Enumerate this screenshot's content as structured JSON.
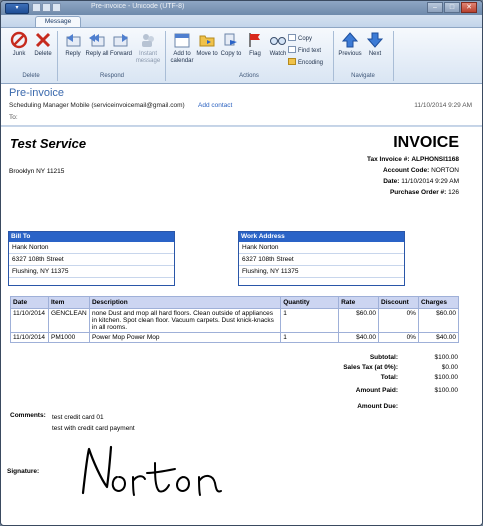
{
  "window": {
    "title": "Pre-invoice - Unicode (UTF-8)",
    "app_button": "▾",
    "controls": {
      "minimize": "–",
      "maximize": "□",
      "close": "✕"
    }
  },
  "tabs": [
    {
      "label": "Message"
    }
  ],
  "ribbon": {
    "groups": [
      {
        "label": "Delete"
      },
      {
        "label": "Respond"
      },
      {
        "label": "Actions"
      },
      {
        "label": "Navigate"
      }
    ],
    "buttons": {
      "junk": "Junk",
      "delete": "Delete",
      "reply": "Reply",
      "reply_all": "Reply all",
      "forward": "Forward",
      "instant_message": "Instant message",
      "add_to_calendar": "Add to calendar",
      "move_to": "Move to",
      "copy_to": "Copy to",
      "flag": "Flag",
      "watch": "Watch",
      "copy": "Copy",
      "find_text": "Find text",
      "encoding": "Encoding",
      "previous": "Previous",
      "next": "Next"
    }
  },
  "message": {
    "subject": "Pre-invoice",
    "from": "Scheduling Manager Mobile (serviceinvoicemail@gmail.com)",
    "add_contact": "Add contact",
    "date": "11/10/2014 9:29 AM",
    "to_label": "To:"
  },
  "invoice": {
    "company": "Test Service",
    "title": "INVOICE",
    "address": "Brooklyn NY 11215",
    "meta": [
      {
        "label": "Tax Invoice #:",
        "value": "ALPHONSI1168"
      },
      {
        "label": "Account Code:",
        "value": "NORTON"
      },
      {
        "label": "Date:",
        "value": "11/10/2014 9:29 AM"
      },
      {
        "label": "Purchase Order #:",
        "value": "126"
      }
    ],
    "bill_to": {
      "heading": "Bill To",
      "lines": [
        "Hank Norton",
        "6327 108th Street",
        "Flushing, NY 11375"
      ]
    },
    "work_address": {
      "heading": "Work Address",
      "lines": [
        "Hank Norton",
        "6327 108th Street",
        "Flushing, NY 11375"
      ]
    },
    "table": {
      "headers": [
        "Date",
        "Item",
        "Description",
        "Quantity",
        "Rate",
        "Discount",
        "Charges"
      ],
      "rows": [
        [
          "11/10/2014",
          "GENCLEAN",
          "none Dust and mop all hard floors. Clean outside of appliances in kitchen. Spot clean floor. Vacuum carpets. Dust knick-knacks in all rooms.",
          "1",
          "$60.00",
          "0%",
          "$60.00"
        ],
        [
          "11/10/2014",
          "PM1000",
          "Power Mop Power Mop",
          "1",
          "$40.00",
          "0%",
          "$40.00"
        ]
      ]
    },
    "totals": [
      {
        "label": "Subtotal:",
        "value": "$100.00"
      },
      {
        "label": "Sales Tax (at 0%):",
        "value": "$0.00"
      },
      {
        "label": "Total:",
        "value": "$100.00"
      },
      {
        "label": "Amount Paid:",
        "value": "$100.00"
      },
      {
        "label": "Amount Due:",
        "value": ""
      }
    ],
    "comments_label": "Comments:",
    "comments": [
      "test credit card 01",
      "test with credit card payment"
    ],
    "signature_label": "Signature:",
    "signature_text": "Norton"
  }
}
